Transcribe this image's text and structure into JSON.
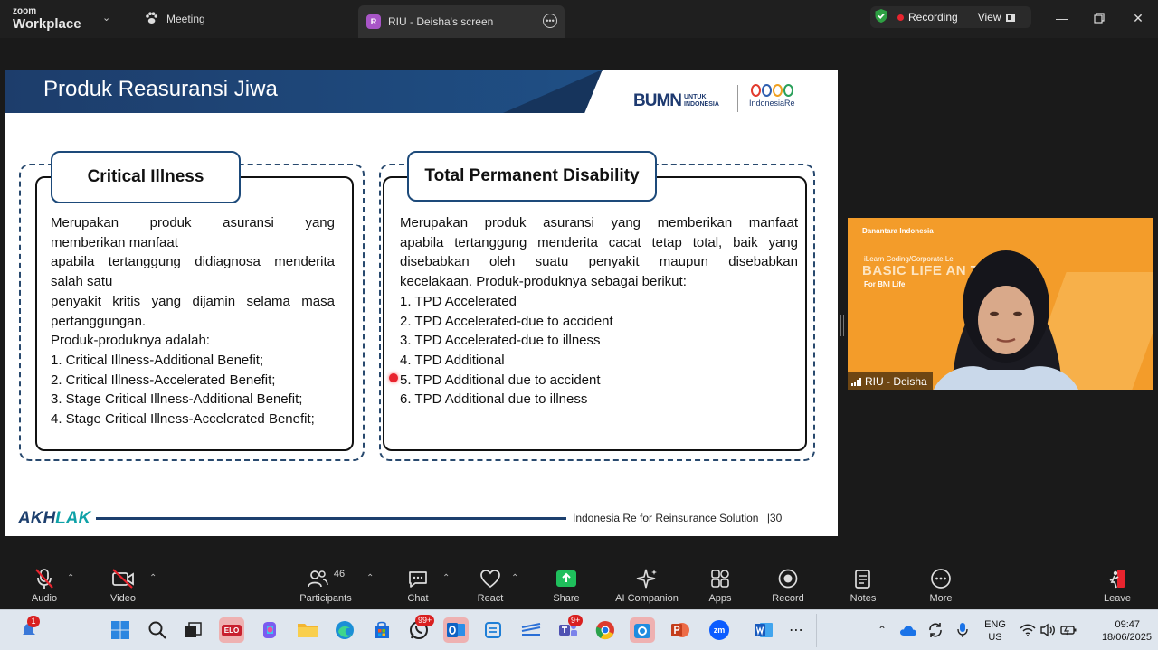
{
  "app": {
    "brand_top": "zoom",
    "brand_bottom": "Workplace",
    "tabs": [
      {
        "label": "Meeting"
      },
      {
        "label": "RIU - Deisha's screen",
        "badge": "R"
      }
    ],
    "recording_label": "Recording",
    "view_label": "View",
    "accent_recording": "#e8242e",
    "shield_color": "#2ea043"
  },
  "slide": {
    "title": "Produk Reasuransi Jiwa",
    "logo_bumn": "BUMN",
    "logo_bumn_sub": "UNTUK INDONESIA",
    "logo_ire": "IndonesiaRe",
    "left_card": {
      "title": "Critical Illness",
      "lines": [
        "Merupakan produk asuransi yang",
        "memberikan manfaat",
        "apabila tertanggung didiagnosa menderita",
        "salah satu",
        "penyakit kritis yang dijamin selama masa",
        "pertanggungan.",
        "Produk-produknya adalah:",
        "1. Critical Illness-Additional Benefit;",
        "2. Critical Illness-Accelerated Benefit;",
        "3. Stage Critical Illness-Additional Benefit;",
        "4. Stage Critical Illness-Accelerated Benefit;"
      ]
    },
    "right_card": {
      "title": "Total Permanent Disability",
      "lines": [
        "Merupakan produk asuransi yang memberikan manfaat",
        "apabila tertanggung menderita cacat tetap total, baik yang",
        "disebabkan oleh suatu penyakit maupun disebabkan",
        "kecelakaan. Produk-produknya sebagai berikut:",
        "1. TPD Accelerated",
        "2. TPD Accelerated-due to accident",
        "3. TPD Accelerated-due to illness",
        "4. TPD Additional",
        "5. TPD Additional due to accident",
        "6. TPD Additional due to illness"
      ]
    },
    "footer_brand_a": "AKH",
    "footer_brand_b": "LAK",
    "footer_text": "Indonesia Re for Reinsurance Solution",
    "page_number": "|30"
  },
  "video": {
    "name": "RIU - Deisha",
    "banner_small": "iLearn Coding/Corporate Le",
    "banner_big": "BASIC LIFE AN         TRAINING",
    "banner_sub": "For BNI Life",
    "banner_logo": "Danantara Indonesia"
  },
  "toolbar": {
    "items": [
      {
        "label": "Audio"
      },
      {
        "label": "Video"
      },
      {
        "label": "Participants",
        "count": "46"
      },
      {
        "label": "Chat"
      },
      {
        "label": "React"
      },
      {
        "label": "Share"
      },
      {
        "label": "AI Companion"
      },
      {
        "label": "Apps"
      },
      {
        "label": "Record"
      },
      {
        "label": "Notes"
      },
      {
        "label": "More"
      },
      {
        "label": "Leave"
      }
    ],
    "share_color": "#1fbf5c"
  },
  "taskbar": {
    "notif_badge": "1",
    "whatsapp_badge": "99+",
    "teams_badge": "9+",
    "lang_top": "ENG",
    "lang_bottom": "US",
    "time": "09:47",
    "date": "18/06/2025",
    "app_label_elo": "ELO",
    "app_label_zoom": "zm"
  }
}
